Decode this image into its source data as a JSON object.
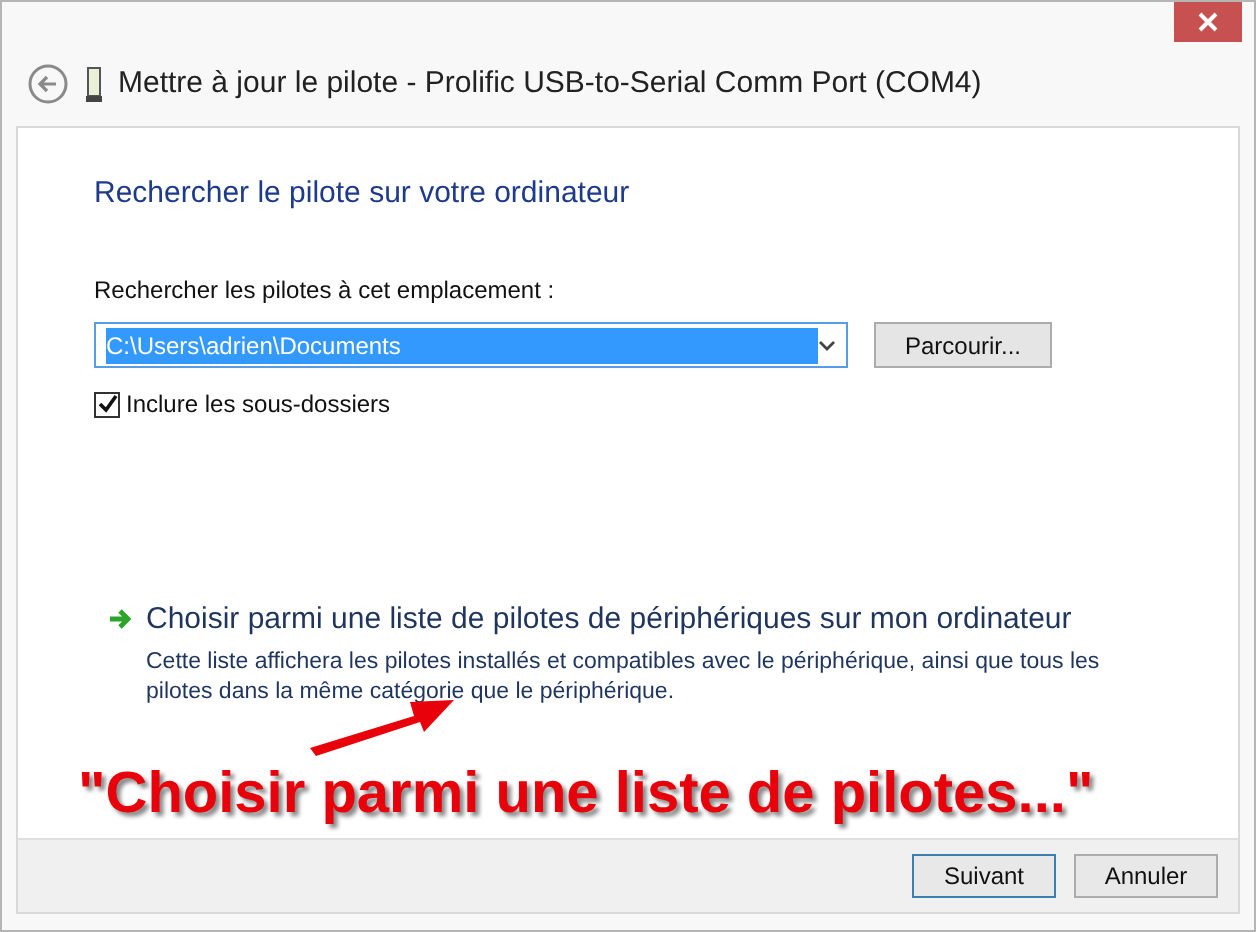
{
  "window": {
    "title": "Mettre à jour le pilote - Prolific USB-to-Serial Comm Port (COM4)"
  },
  "heading": "Rechercher le pilote sur votre ordinateur",
  "location": {
    "label": "Rechercher les pilotes à cet emplacement :",
    "value": "C:\\Users\\adrien\\Documents",
    "browse_button": "Parcourir..."
  },
  "include_subfolders": {
    "label": "Inclure les sous-dossiers",
    "checked": true
  },
  "pick_link": {
    "title": "Choisir parmi une liste de pilotes de périphériques sur mon ordinateur",
    "description": "Cette liste affichera les pilotes installés et compatibles avec le périphérique, ainsi que tous les pilotes dans la même catégorie que le périphérique."
  },
  "annotation": "\"Choisir parmi une liste de pilotes...\"",
  "buttons": [
    "Suivant",
    "Annuler"
  ]
}
